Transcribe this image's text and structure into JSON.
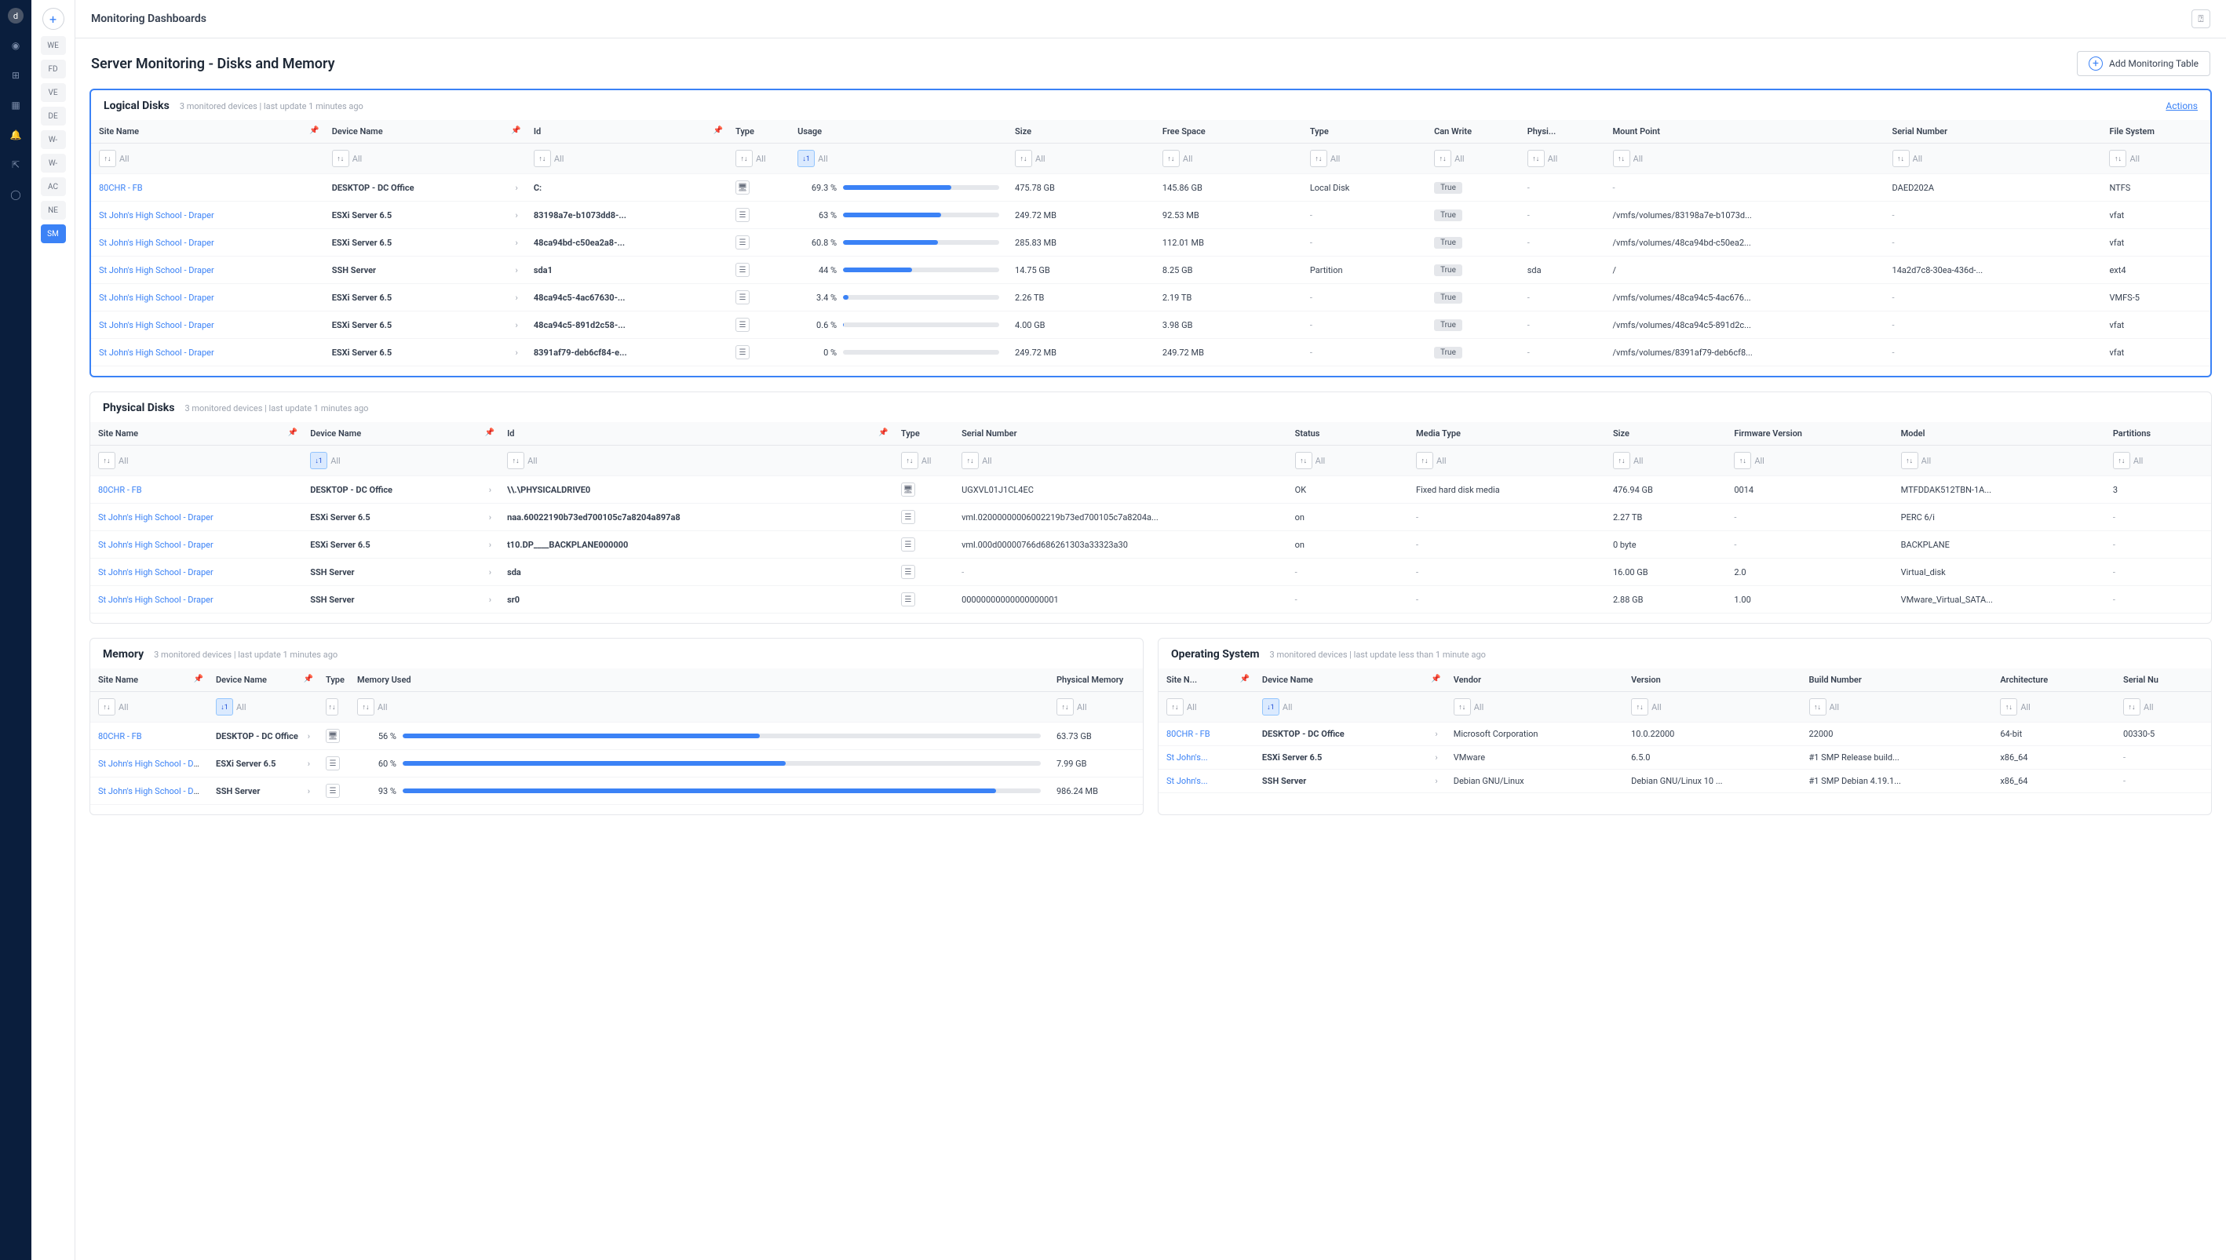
{
  "topbar": {
    "title": "Monitoring Dashboards"
  },
  "page": {
    "title": "Server Monitoring - Disks and Memory",
    "add_btn": "Add Monitoring Table"
  },
  "sites": [
    "WE",
    "FD",
    "VE",
    "DE",
    "W-",
    "W-",
    "AC",
    "NE",
    "SM"
  ],
  "filter_placeholder": "All",
  "actions_label": "Actions",
  "logical_disks": {
    "title": "Logical Disks",
    "subtitle": "3 monitored devices | last update 1 minutes ago",
    "headers": [
      "Site Name",
      "Device Name",
      "Id",
      "Type",
      "Usage",
      "Size",
      "Free Space",
      "Type",
      "Can Write",
      "Physi...",
      "Mount Point",
      "Serial Number",
      "File System"
    ],
    "rows": [
      {
        "site": "80CHR - FB",
        "device": "DESKTOP - DC Office",
        "id": "C:",
        "usage": 69.3,
        "size": "475.78 GB",
        "free": "145.86 GB",
        "type2": "Local Disk",
        "canwrite": "True",
        "phys": "-",
        "mount": "-",
        "serial": "DAED202A",
        "fs": "NTFS",
        "icon": "desktop"
      },
      {
        "site": "St John's High School - Draper",
        "device": "ESXi Server 6.5",
        "id": "83198a7e-b1073dd8-...",
        "usage": 63.0,
        "size": "249.72 MB",
        "free": "92.53 MB",
        "type2": "-",
        "canwrite": "True",
        "phys": "-",
        "mount": "/vmfs/volumes/83198a7e-b1073d...",
        "serial": "-",
        "fs": "vfat",
        "icon": "server"
      },
      {
        "site": "St John's High School - Draper",
        "device": "ESXi Server 6.5",
        "id": "48ca94bd-c50ea2a8-...",
        "usage": 60.8,
        "size": "285.83 MB",
        "free": "112.01 MB",
        "type2": "-",
        "canwrite": "True",
        "phys": "-",
        "mount": "/vmfs/volumes/48ca94bd-c50ea2...",
        "serial": "-",
        "fs": "vfat",
        "icon": "server"
      },
      {
        "site": "St John's High School - Draper",
        "device": "SSH Server",
        "id": "sda1",
        "usage": 44.0,
        "size": "14.75 GB",
        "free": "8.25 GB",
        "type2": "Partition",
        "canwrite": "True",
        "phys": "sda",
        "mount": "/",
        "serial": "14a2d7c8-30ea-436d-...",
        "fs": "ext4",
        "icon": "server"
      },
      {
        "site": "St John's High School - Draper",
        "device": "ESXi Server 6.5",
        "id": "48ca94c5-4ac67630-...",
        "usage": 3.4,
        "size": "2.26 TB",
        "free": "2.19 TB",
        "type2": "-",
        "canwrite": "True",
        "phys": "-",
        "mount": "/vmfs/volumes/48ca94c5-4ac676...",
        "serial": "-",
        "fs": "VMFS-5",
        "icon": "server"
      },
      {
        "site": "St John's High School - Draper",
        "device": "ESXi Server 6.5",
        "id": "48ca94c5-891d2c58-...",
        "usage": 0.6,
        "size": "4.00 GB",
        "free": "3.98 GB",
        "type2": "-",
        "canwrite": "True",
        "phys": "-",
        "mount": "/vmfs/volumes/48ca94c5-891d2c...",
        "serial": "-",
        "fs": "vfat",
        "icon": "server"
      },
      {
        "site": "St John's High School - Draper",
        "device": "ESXi Server 6.5",
        "id": "8391af79-deb6cf84-e...",
        "usage": 0,
        "size": "249.72 MB",
        "free": "249.72 MB",
        "type2": "-",
        "canwrite": "True",
        "phys": "-",
        "mount": "/vmfs/volumes/8391af79-deb6cf8...",
        "serial": "-",
        "fs": "vfat",
        "icon": "server"
      }
    ]
  },
  "physical_disks": {
    "title": "Physical Disks",
    "subtitle": "3 monitored devices | last update 1 minutes ago",
    "headers": [
      "Site Name",
      "Device Name",
      "Id",
      "Type",
      "Serial Number",
      "Status",
      "Media Type",
      "Size",
      "Firmware Version",
      "Model",
      "Partitions"
    ],
    "rows": [
      {
        "site": "80CHR - FB",
        "device": "DESKTOP - DC Office",
        "id": "\\\\.\\PHYSICALDRIVE0",
        "serial": "UGXVL01J1CL4EC",
        "status": "OK",
        "media": "Fixed hard disk media",
        "size": "476.94 GB",
        "fw": "0014",
        "model": "MTFDDAK512TBN-1A...",
        "parts": "3",
        "icon": "desktop"
      },
      {
        "site": "St John's High School - Draper",
        "device": "ESXi Server 6.5",
        "id": "naa.60022190b73ed700105c7a8204a897a8",
        "serial": "vml.02000000006002219b73ed700105c7a8204a...",
        "status": "on",
        "media": "-",
        "size": "2.27 TB",
        "fw": "-",
        "model": "PERC 6/i",
        "parts": "-",
        "icon": "server"
      },
      {
        "site": "St John's High School - Draper",
        "device": "ESXi Server 6.5",
        "id": "t10.DP____BACKPLANE000000",
        "serial": "vml.000d00000766d686261303a33323a30",
        "status": "on",
        "media": "-",
        "size": "0 byte",
        "fw": "-",
        "model": "BACKPLANE",
        "parts": "-",
        "icon": "server"
      },
      {
        "site": "St John's High School - Draper",
        "device": "SSH Server",
        "id": "sda",
        "serial": "-",
        "status": "-",
        "media": "-",
        "size": "16.00 GB",
        "fw": "2.0",
        "model": "Virtual_disk",
        "parts": "-",
        "icon": "server"
      },
      {
        "site": "St John's High School - Draper",
        "device": "SSH Server",
        "id": "sr0",
        "serial": "00000000000000000001",
        "status": "-",
        "media": "-",
        "size": "2.88 GB",
        "fw": "1.00",
        "model": "VMware_Virtual_SATA...",
        "parts": "-",
        "icon": "server"
      }
    ]
  },
  "memory": {
    "title": "Memory",
    "subtitle": "3 monitored devices | last update 1 minutes ago",
    "headers": [
      "Site Name",
      "Device Name",
      "Type",
      "Memory Used",
      "Physical Memory"
    ],
    "rows": [
      {
        "site": "80CHR - FB",
        "device": "DESKTOP - DC Office",
        "used": 56,
        "phys": "63.73 GB",
        "icon": "desktop"
      },
      {
        "site": "St John's High School - Draper",
        "device": "ESXi Server 6.5",
        "used": 60,
        "phys": "7.99 GB",
        "icon": "server"
      },
      {
        "site": "St John's High School - Draper",
        "device": "SSH Server",
        "used": 93,
        "phys": "986.24 MB",
        "icon": "server"
      }
    ]
  },
  "os": {
    "title": "Operating System",
    "subtitle": "3 monitored devices | last update less than 1 minute ago",
    "headers": [
      "Site N...",
      "Device Name",
      "Vendor",
      "Version",
      "Build Number",
      "Architecture",
      "Serial Nu"
    ],
    "rows": [
      {
        "site": "80CHR - FB",
        "device": "DESKTOP - DC Office",
        "vendor": "Microsoft Corporation",
        "version": "10.0.22000",
        "build": "22000",
        "arch": "64-bit",
        "serial": "00330-5"
      },
      {
        "site": "St John's...",
        "device": "ESXi Server 6.5",
        "vendor": "VMware",
        "version": "6.5.0",
        "build": "#1 SMP Release build...",
        "arch": "x86_64",
        "serial": "-"
      },
      {
        "site": "St John's...",
        "device": "SSH Server",
        "vendor": "Debian GNU/Linux",
        "version": "Debian GNU/Linux 10 ...",
        "build": "#1 SMP Debian 4.19.1...",
        "arch": "x86_64",
        "serial": "-"
      }
    ]
  }
}
